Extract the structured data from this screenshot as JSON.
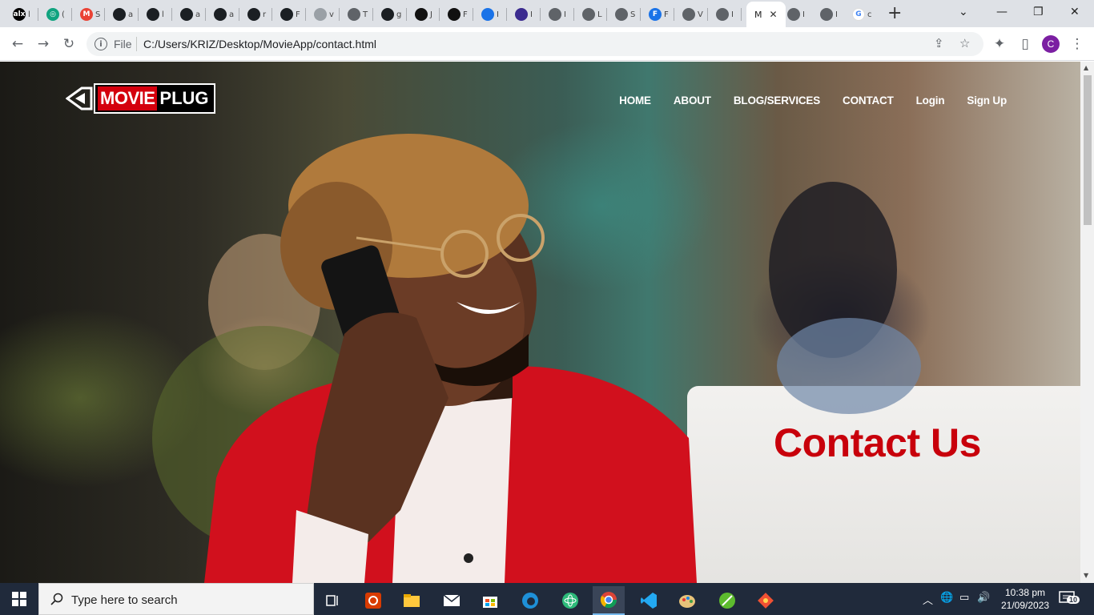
{
  "browser": {
    "tabs": [
      {
        "letter": "alx",
        "color": "#000000",
        "text": "l"
      },
      {
        "letter": "◎",
        "color": "#10a37f",
        "text": "("
      },
      {
        "letter": "M",
        "color": "#ea4335",
        "text": "S"
      },
      {
        "letter": "",
        "color": "#1b1f23",
        "text": "a"
      },
      {
        "letter": "",
        "color": "#1b1f23",
        "text": "l"
      },
      {
        "letter": "",
        "color": "#1b1f23",
        "text": "a"
      },
      {
        "letter": "",
        "color": "#1b1f23",
        "text": "a"
      },
      {
        "letter": "",
        "color": "#1b1f23",
        "text": "r"
      },
      {
        "letter": "",
        "color": "#1b1f23",
        "text": "F"
      },
      {
        "letter": "",
        "color": "#9aa0a6",
        "text": "v"
      },
      {
        "letter": "",
        "color": "#5f6368",
        "text": "T"
      },
      {
        "letter": "",
        "color": "#1b1f23",
        "text": "g"
      },
      {
        "letter": "",
        "color": "#111111",
        "text": "J"
      },
      {
        "letter": "",
        "color": "#111111",
        "text": "F"
      },
      {
        "letter": "",
        "color": "#1a73e8",
        "text": "I"
      },
      {
        "letter": "",
        "color": "#3b2b8f",
        "text": "I"
      },
      {
        "letter": "",
        "color": "#5f6368",
        "text": "I"
      },
      {
        "letter": "",
        "color": "#5f6368",
        "text": "L"
      },
      {
        "letter": "",
        "color": "#5f6368",
        "text": "S"
      },
      {
        "letter": "F",
        "color": "#1a73e8",
        "text": "F"
      },
      {
        "letter": "",
        "color": "#5f6368",
        "text": "V"
      },
      {
        "letter": "",
        "color": "#5f6368",
        "text": "I"
      }
    ],
    "active_tab": {
      "title": "M"
    },
    "after_tabs": [
      {
        "text": "I"
      },
      {
        "text": "I"
      }
    ],
    "google_tab": {
      "text": "c"
    },
    "scheme_label": "File",
    "url": "C:/Users/KRIZ/Desktop/MovieApp/contact.html",
    "profile_initial": "C"
  },
  "page": {
    "brand": {
      "movie": "MOVIE",
      "plug": "PLUG"
    },
    "nav": [
      {
        "label": "HOME"
      },
      {
        "label": "ABOUT"
      },
      {
        "label": "BLOG/SERVICES"
      },
      {
        "label": "CONTACT"
      },
      {
        "label": "Login"
      },
      {
        "label": "Sign Up"
      }
    ],
    "hero_title": "Contact Us",
    "accent_color": "#c8000b"
  },
  "taskbar": {
    "search_placeholder": "Type here to search",
    "time": "10:38 pm",
    "date": "21/09/2023",
    "notification_count": "10"
  }
}
